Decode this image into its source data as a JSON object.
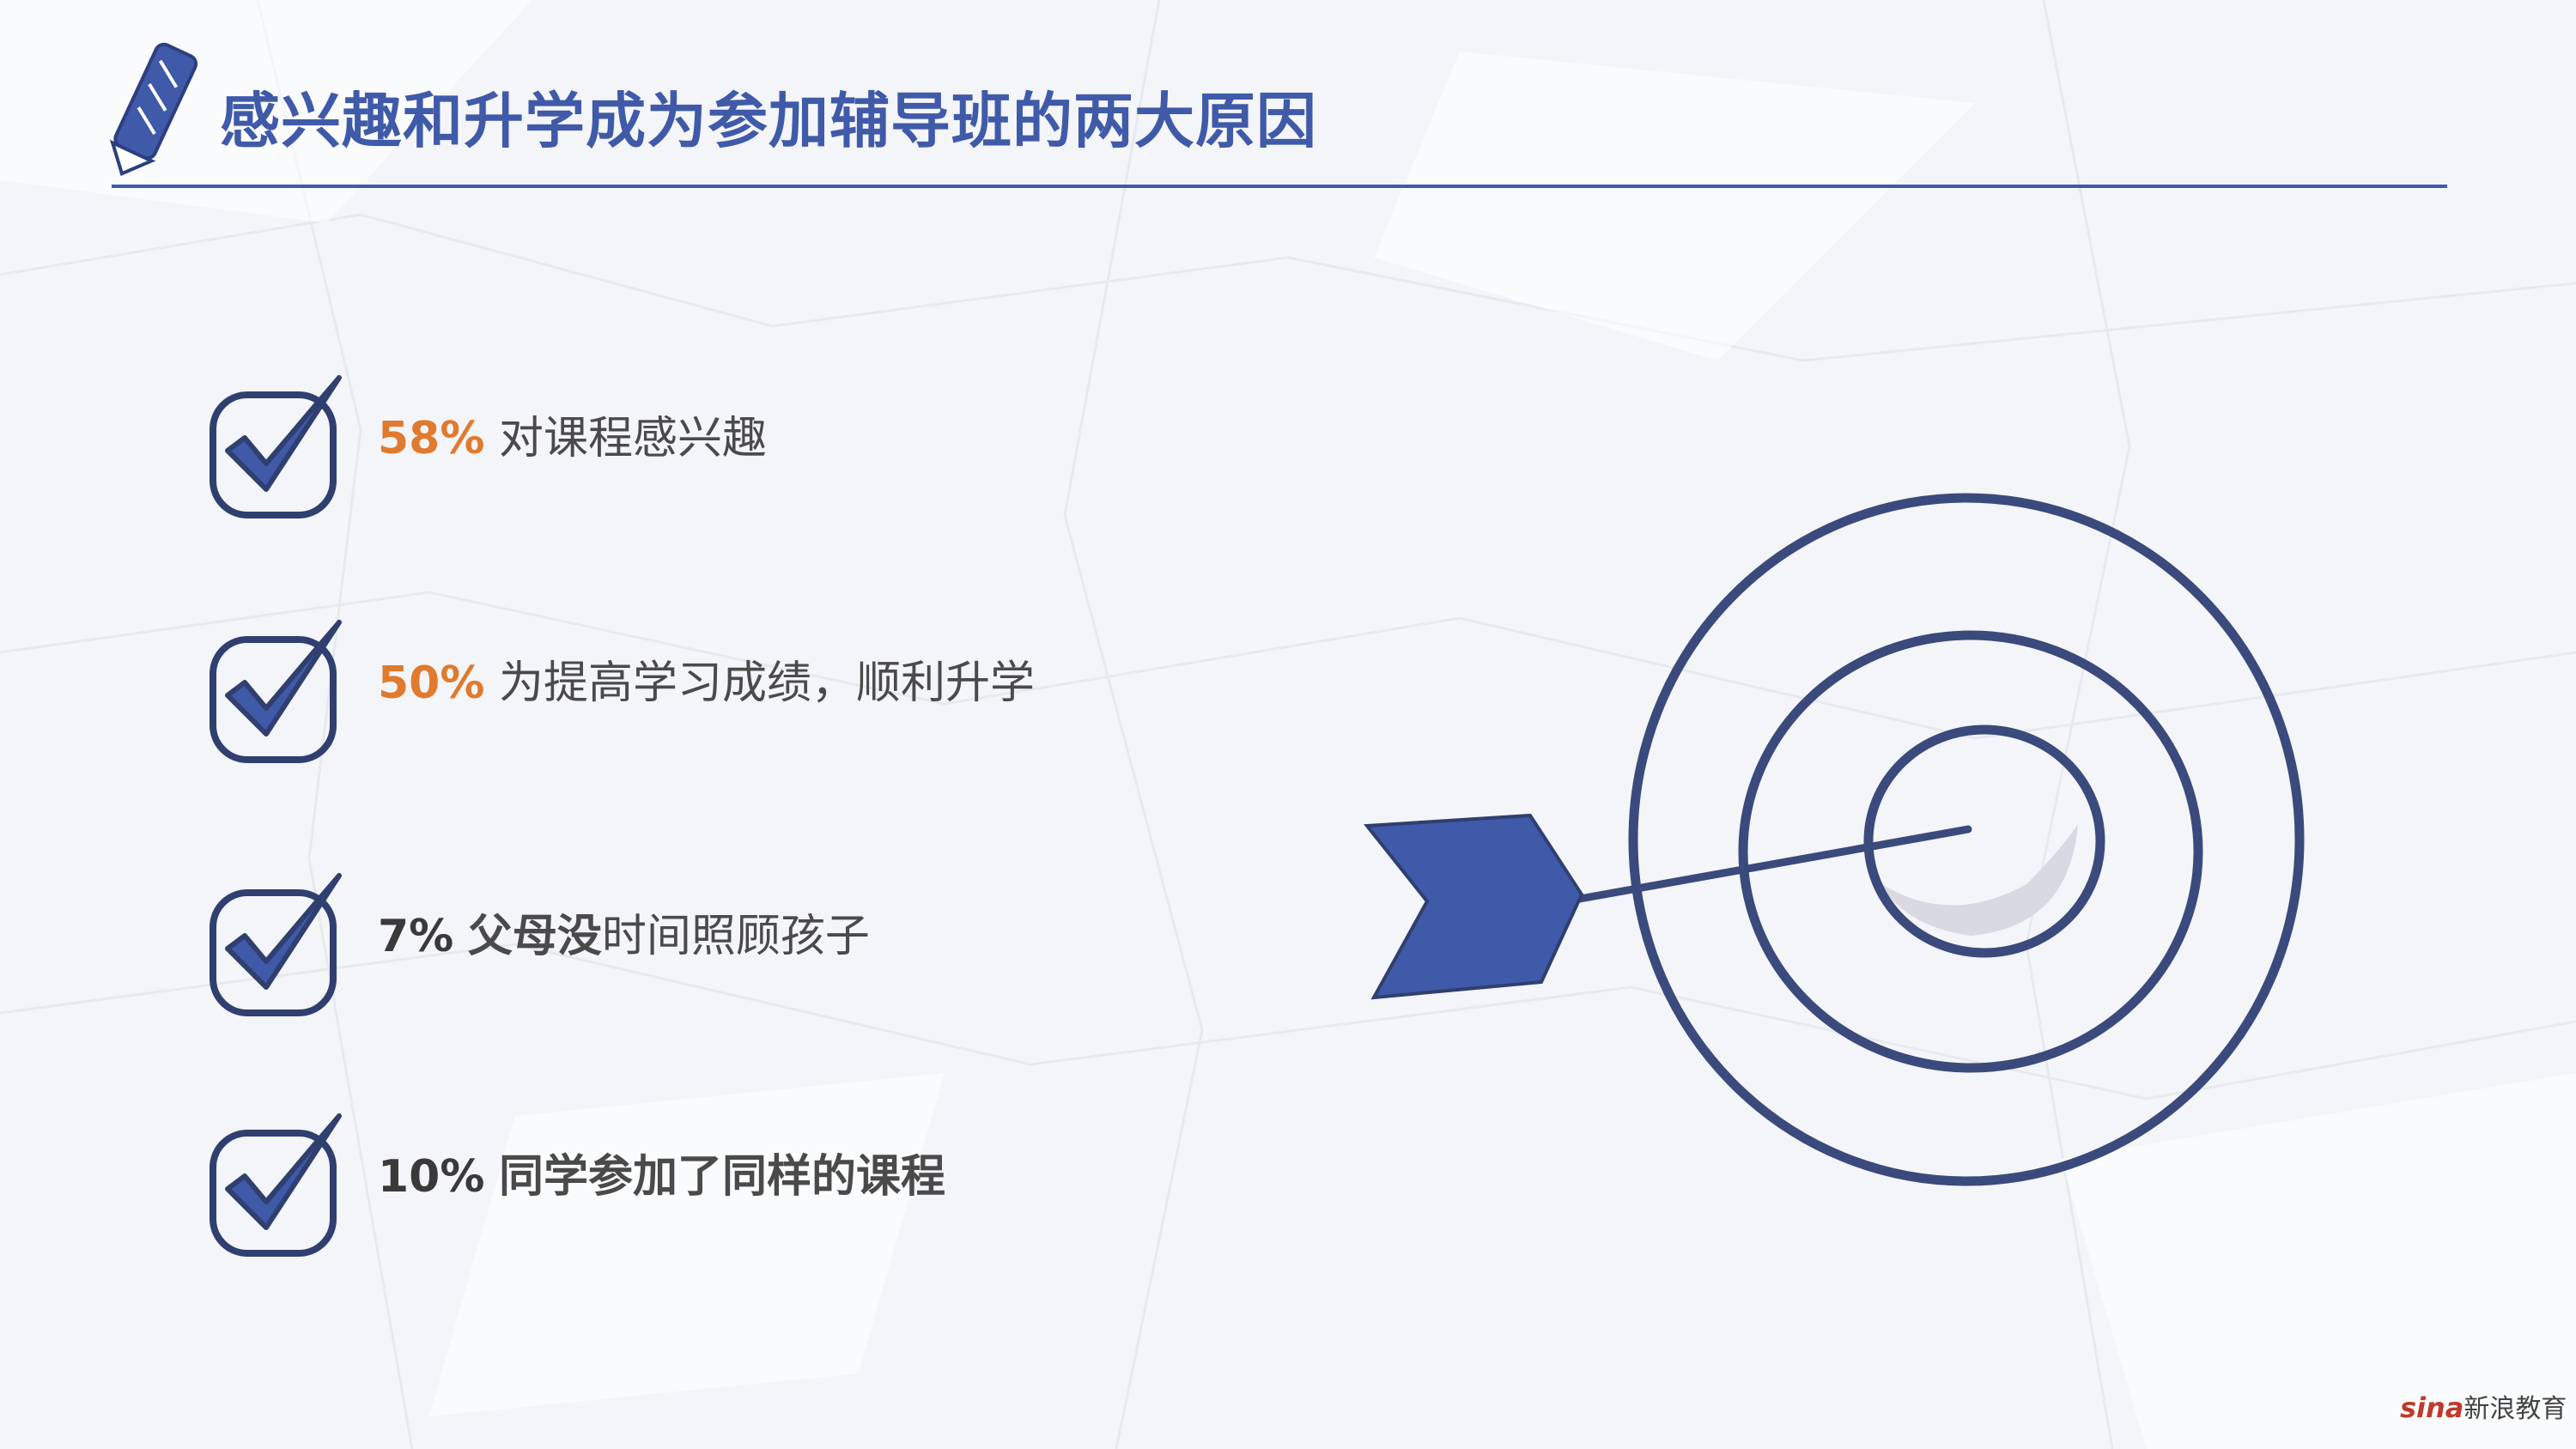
{
  "slide": {
    "title": "感兴趣和升学成为参加辅导班的两大原因",
    "colors": {
      "accent_blue": "#3f5aa8",
      "orange": "#e07a2f",
      "text_gray": "#4a4a4a"
    },
    "items": [
      {
        "pct": "58%",
        "text": "对课程感兴趣",
        "strong_text": ""
      },
      {
        "pct": "50%",
        "text": "为提高学习成绩，顺利升学",
        "strong_text": ""
      },
      {
        "pct": "7%",
        "strong_text": "父母没",
        "text": "时间照顾孩子"
      },
      {
        "pct": "10%",
        "strong_text": "同学参加了同样的课程",
        "text": ""
      }
    ],
    "icons": {
      "title": "pencil-icon",
      "item": "checkbox-check-icon",
      "graphic": "target-arrow-icon"
    },
    "logo": {
      "brand": "sina",
      "label": "新浪教育"
    }
  }
}
